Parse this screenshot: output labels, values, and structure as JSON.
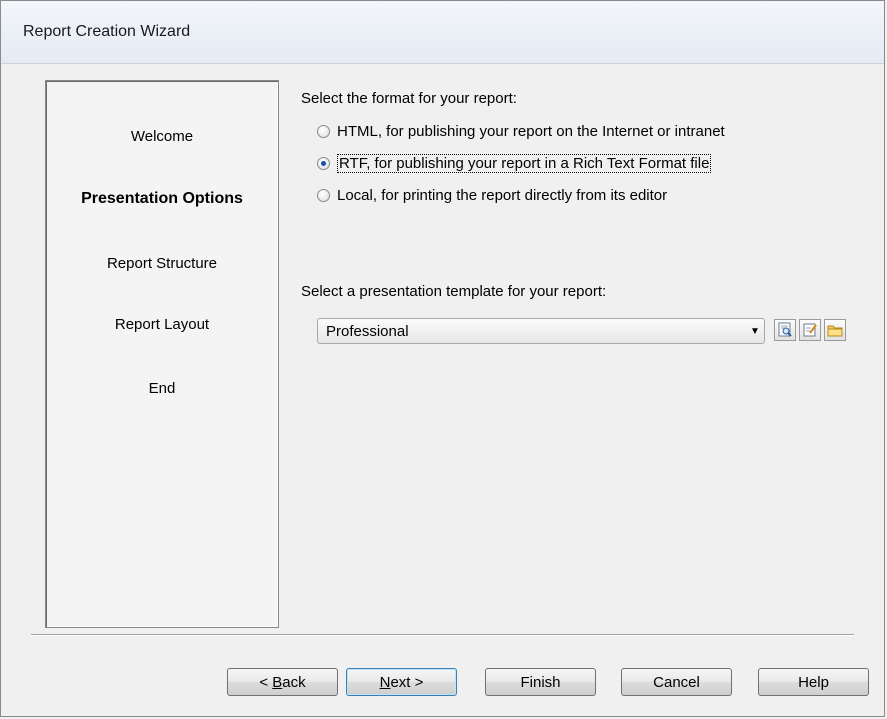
{
  "window": {
    "title": "Report Creation Wizard"
  },
  "steps": [
    {
      "label": "Welcome",
      "active": false
    },
    {
      "label": "Presentation Options",
      "active": true
    },
    {
      "label": "Report Structure",
      "active": false
    },
    {
      "label": "Report Layout",
      "active": false
    },
    {
      "label": "End",
      "active": false
    }
  ],
  "format": {
    "heading": "Select the format for your report:",
    "options": [
      {
        "label": "HTML, for publishing your report on the Internet or intranet",
        "checked": false
      },
      {
        "label": "RTF, for publishing your report in a Rich Text Format file",
        "checked": true
      },
      {
        "label": "Local, for printing the report directly from its editor",
        "checked": false
      }
    ]
  },
  "template": {
    "heading": "Select a presentation template for your report:",
    "selected": "Professional",
    "icons": [
      "preview-icon",
      "edit-icon",
      "folder-icon"
    ]
  },
  "buttons": {
    "back_prefix": "< ",
    "back_accel": "B",
    "back_rest": "ack",
    "next_accel": "N",
    "next_rest": "ext >",
    "finish": "Finish",
    "cancel": "Cancel",
    "help": "Help"
  }
}
